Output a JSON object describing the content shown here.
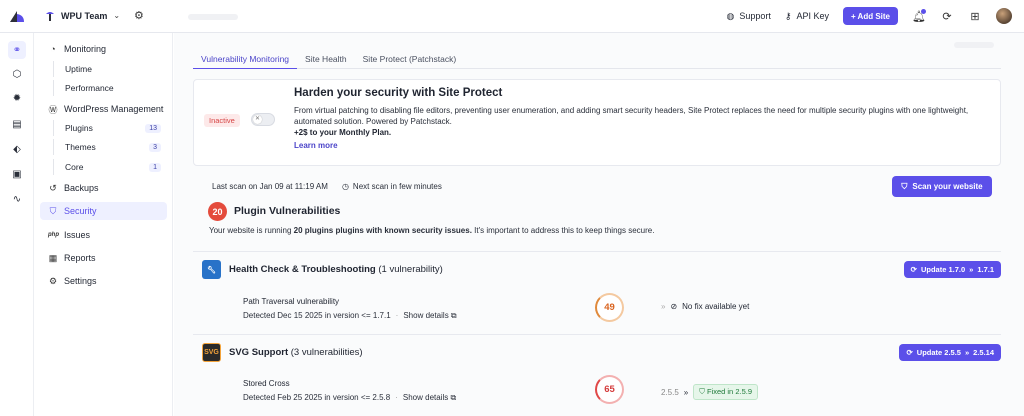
{
  "header": {
    "team_name": "WPU Team",
    "support_label": "Support",
    "api_key_label": "API Key",
    "add_site_label": "+ Add Site"
  },
  "sidebar": {
    "monitoring": "Monitoring",
    "uptime": "Uptime",
    "performance": "Performance",
    "wp_management": "WordPress Management",
    "plugins": "Plugins",
    "plugins_count": "13",
    "themes": "Themes",
    "themes_count": "3",
    "core": "Core",
    "core_count": "1",
    "backups": "Backups",
    "security": "Security",
    "issues": "Issues",
    "reports": "Reports",
    "settings": "Settings",
    "issues_icon_text": "php"
  },
  "tabs": [
    "Vulnerability Monitoring",
    "Site Health",
    "Site Protect (Patchstack)"
  ],
  "harden": {
    "status": "Inactive",
    "title": "Harden your security with Site Protect",
    "description": "From virtual patching to disabling file editors, preventing user enumeration, and adding smart security headers, Site Protect replaces the need for multiple security plugins with one lightweight, automated solution. Powered by Patchstack.",
    "price": "+2$ to your Monthly Plan.",
    "learn_more": "Learn more"
  },
  "scan": {
    "last_scan": "Last scan on Jan 09 at 11:19 AM",
    "next_scan": "Next scan in few minutes",
    "button": "Scan your website"
  },
  "summary": {
    "count": "20",
    "title": "Plugin Vulnerabilities",
    "desc_prefix": "Your website is running ",
    "desc_bold": "20 plugins plugins with known security issues.",
    "desc_suffix": " It's important to address this to keep things secure."
  },
  "plugins": [
    {
      "name": "Health Check & Troubleshooting",
      "vuln_count": "(1 vulnerability)",
      "update_label": "Update 1.7.0",
      "update_to": "1.7.1",
      "vulns": [
        {
          "name": "Path Traversal vulnerability",
          "detected": "Detected Dec 15 2025 in version <= 1.7.1",
          "details": "Show details",
          "score": "49",
          "fix_text": "No fix available yet"
        }
      ]
    },
    {
      "name": "SVG Support",
      "vuln_count": "(3 vulnerabilities)",
      "update_label": "Update 2.5.5",
      "update_to": "2.5.14",
      "icon_text": "SVG",
      "vulns": [
        {
          "name": "Stored Cross",
          "detected": "Detected Feb 25 2025 in version <= 2.5.8",
          "details": "Show details",
          "score": "65",
          "from_version": "2.5.5",
          "fixed_label": "Fixed in",
          "fixed_version": "2.5.9"
        }
      ]
    }
  ],
  "colors": {
    "accent": "#5b4fe9",
    "danger": "#e44b3c",
    "success": "#1f7a3a"
  }
}
